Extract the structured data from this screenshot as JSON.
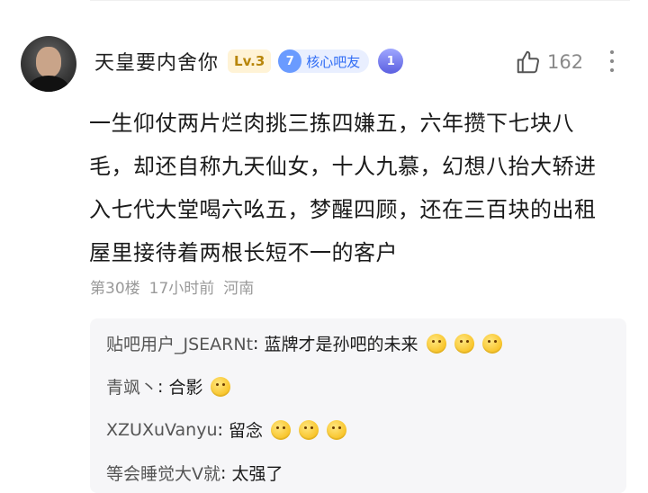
{
  "post": {
    "username": "天皇要内舍你",
    "level": "Lv.3",
    "member_rank_num": "7",
    "member_label": "核心吧友",
    "rank_icon_num": "1",
    "like_count": "162",
    "content": "一生仰仗两片烂肉挑三拣四嫌五，六年攒下七块八毛，却还自称九天仙女，十人九慕，幻想八抬大轿进入七代大堂喝六吆五，梦醒四顾，还在三百块的出租屋里接待着两根长短不一的客户",
    "floor": "第30楼",
    "time": "17小时前",
    "location": "河南"
  },
  "replies": [
    {
      "name": "贴吧用户_JSEARNt",
      "text": "蓝牌才是孙吧的未来",
      "emoji_count": 3
    },
    {
      "name": "青飒丶",
      "text": "合影",
      "emoji_count": 1
    },
    {
      "name": "XZUXuVanyu",
      "text": "留念",
      "emoji_count": 3
    },
    {
      "name": "等会睡觉大V就",
      "text": "太强了",
      "emoji_count": 0
    }
  ],
  "icons": {
    "like": "thumbs-up-icon",
    "more": "more-vertical-icon",
    "emoji": "laughing-face-emoji"
  },
  "colors": {
    "accent_blue": "#2f6cf5",
    "level_gold": "#b8860b",
    "meta_gray": "#9a9a9a",
    "reply_bg": "#f6f6f8"
  }
}
